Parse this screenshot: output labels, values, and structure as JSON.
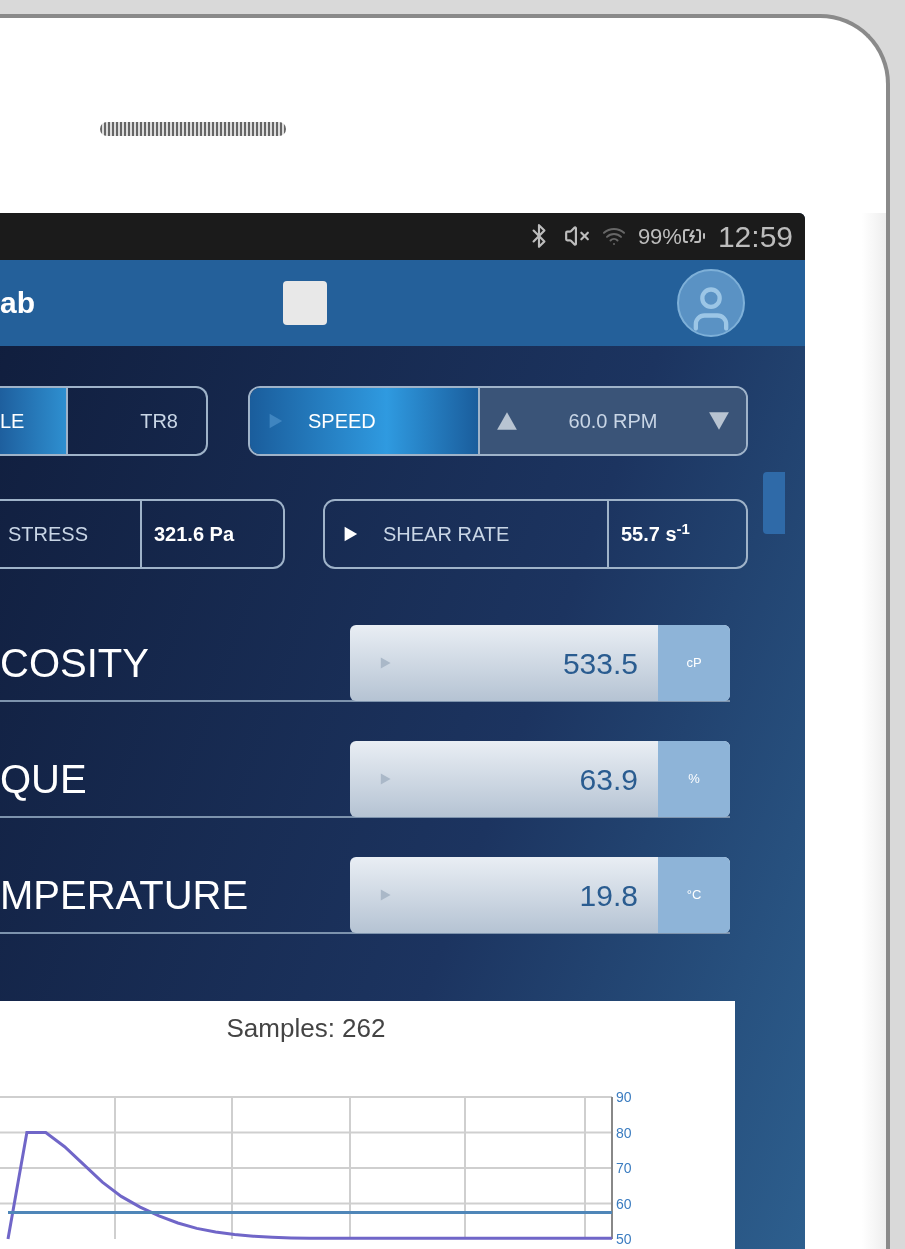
{
  "status_bar": {
    "battery": "99%",
    "time": "12:59"
  },
  "app_bar": {
    "title": "ab"
  },
  "spindle": {
    "label": "LE",
    "selected": true,
    "value": "TR8"
  },
  "speed": {
    "label": "SPEED",
    "selected": true,
    "value": "60.0 RPM"
  },
  "readouts": [
    {
      "kind": "plain",
      "label": "STRESS",
      "value": "321.6 Pa"
    },
    {
      "kind": "arrow",
      "label": "SHEAR RATE",
      "value": "55.7 s$^{-1}$"
    }
  ],
  "measurements": [
    {
      "label": "COSITY",
      "value": "533.5",
      "unit": "cP"
    },
    {
      "label": "QUE",
      "value": "63.9",
      "unit": "%"
    },
    {
      "label": "MPERATURE",
      "value": "19.8",
      "unit": "°C"
    }
  ],
  "chart": {
    "title": "Samples: 262",
    "chart_data": {
      "type": "line",
      "ylim": [
        50,
        90
      ],
      "yticks": [
        50,
        60,
        70,
        80,
        90
      ],
      "series": [
        {
          "color": "#7066c8",
          "values": [
            50,
            80,
            80,
            76,
            71,
            66,
            62,
            59,
            56.5,
            54.5,
            53,
            52,
            51.3,
            50.8,
            50.5,
            50.3,
            50.2,
            50.2,
            50.2,
            50.2,
            50.2,
            50.2,
            50.2,
            50.2,
            50.2,
            50.2,
            50.2,
            50.2,
            50.2,
            50.2,
            50.2,
            50.2,
            50.2
          ]
        },
        {
          "color": "#4f86b8",
          "values": [
            57.5,
            57.5,
            57.5,
            57.5,
            57.5,
            57.5,
            57.5,
            57.5,
            57.5,
            57.5,
            57.5,
            57.5,
            57.5,
            57.5,
            57.5,
            57.5,
            57.5,
            57.5,
            57.5,
            57.5,
            57.5,
            57.5,
            57.5,
            57.5,
            57.5,
            57.5,
            57.5,
            57.5,
            57.5,
            57.5,
            57.5,
            57.5,
            57.5
          ]
        }
      ],
      "grid": true
    }
  }
}
